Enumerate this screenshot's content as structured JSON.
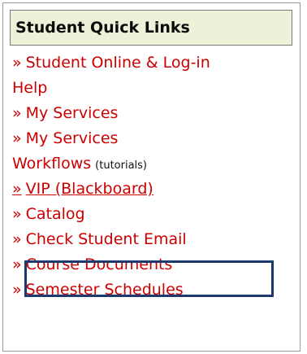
{
  "panel": {
    "title": "Student Quick Links",
    "bullet": "»",
    "links": [
      {
        "label": "Student Online & Log-in",
        "continuation": "Help"
      },
      {
        "label": "My Services"
      },
      {
        "label": "My Services",
        "continuation": "Workflows",
        "note": "(tutorials)"
      },
      {
        "label": "VIP (Blackboard)"
      },
      {
        "label": "Catalog"
      },
      {
        "label": "Check Student Email"
      },
      {
        "label": "Course Documents"
      },
      {
        "label": "Semester Schedules"
      }
    ]
  },
  "colors": {
    "link": "#cc0000",
    "header_bg": "#eef0d8",
    "highlight_border": "#1d3a6e"
  }
}
